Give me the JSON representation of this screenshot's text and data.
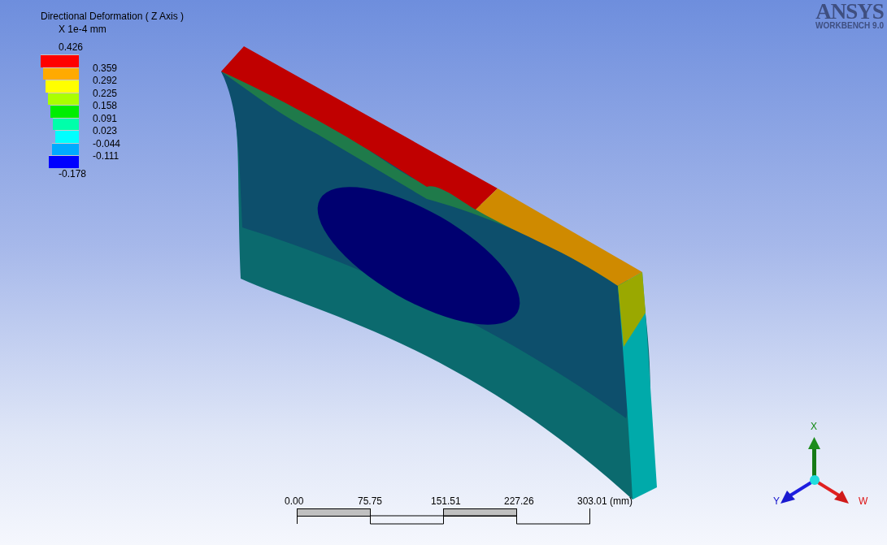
{
  "legend": {
    "title": "Directional Deformation ( Z Axis )",
    "unit": "X 1e-4 mm",
    "max": "0.426",
    "min": "-0.178",
    "bands": [
      {
        "color": "#ff0000",
        "label": "0.359"
      },
      {
        "color": "#ffaa00",
        "label": "0.292"
      },
      {
        "color": "#ffff00",
        "label": "0.225"
      },
      {
        "color": "#aaff00",
        "label": "0.158"
      },
      {
        "color": "#00ee00",
        "label": "0.091"
      },
      {
        "color": "#00ffaa",
        "label": "0.023"
      },
      {
        "color": "#00ffff",
        "label": "-0.044"
      },
      {
        "color": "#00aaff",
        "label": "-0.111"
      },
      {
        "color": "#0000ff"
      }
    ]
  },
  "logo": {
    "name": "ANSYS",
    "product": "WORKBENCH 9.0"
  },
  "triad": {
    "axes": [
      {
        "kind": "up",
        "label": "X"
      },
      {
        "kind": "left",
        "label": "Y"
      },
      {
        "kind": "right",
        "label": "W"
      }
    ]
  },
  "scale_bar": {
    "ticks": [
      "0.00",
      "75.75",
      "151.51",
      "227.26",
      "303.01 (mm)"
    ]
  }
}
